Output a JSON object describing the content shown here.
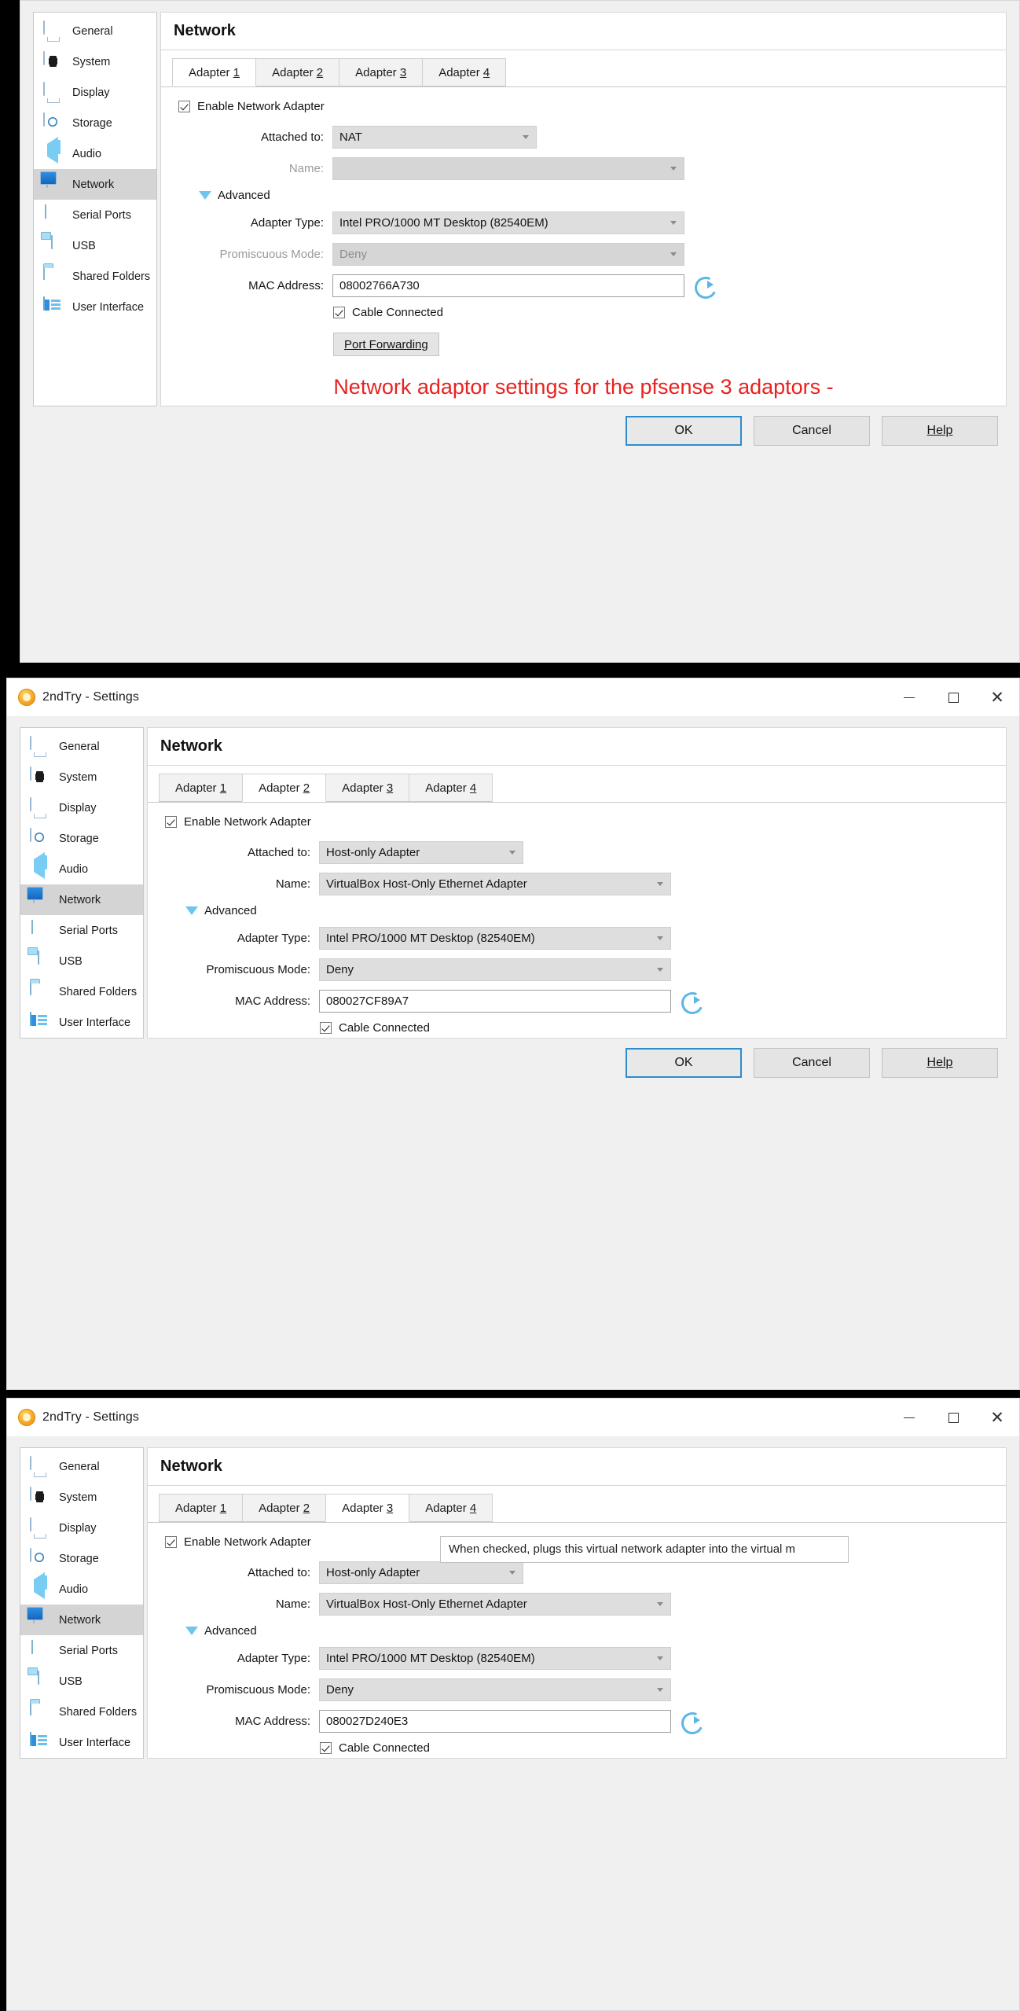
{
  "app": {
    "window_title": "2ndTry - Settings",
    "logo_icon": "virtualbox-logo-icon",
    "window_controls": {
      "minimize": "minimize-icon",
      "maximize": "maximize-icon",
      "close": "close-icon"
    }
  },
  "sidebar": {
    "items": [
      {
        "label": "General",
        "icon": "monitor-icon"
      },
      {
        "label": "System",
        "icon": "chip-icon"
      },
      {
        "label": "Display",
        "icon": "display-icon"
      },
      {
        "label": "Storage",
        "icon": "harddisk-icon"
      },
      {
        "label": "Audio",
        "icon": "speaker-icon"
      },
      {
        "label": "Network",
        "icon": "network-cards-icon"
      },
      {
        "label": "Serial Ports",
        "icon": "serial-port-icon"
      },
      {
        "label": "USB",
        "icon": "usb-plug-icon"
      },
      {
        "label": "Shared Folders",
        "icon": "folder-icon"
      },
      {
        "label": "User Interface",
        "icon": "layout-icon"
      }
    ],
    "selected": "Network"
  },
  "page": {
    "title": "Network"
  },
  "tabs": [
    {
      "label": "Adapter",
      "number": "1"
    },
    {
      "label": "Adapter",
      "number": "2"
    },
    {
      "label": "Adapter",
      "number": "3"
    },
    {
      "label": "Adapter",
      "number": "4"
    }
  ],
  "labels": {
    "enable_adapter": "Enable Network Adapter",
    "attached_to": "Attached to:",
    "name": "Name:",
    "advanced": "Advanced",
    "adapter_type": "Adapter Type:",
    "promiscuous_mode": "Promiscuous Mode:",
    "mac_address": "MAC Address:",
    "cable_connected": "Cable Connected",
    "port_forwarding": "Port Forwarding",
    "refresh_mac_icon": "refresh-icon",
    "advanced_toggle_icon": "triangle-down-icon"
  },
  "footer": {
    "ok": "OK",
    "cancel": "Cancel",
    "help": "Help"
  },
  "windows": [
    {
      "id": "window-adapter-1",
      "active_tab_index": 0,
      "enable_checked": true,
      "attached_to": "NAT",
      "name_value": "",
      "name_disabled": true,
      "adapter_type": "Intel PRO/1000 MT Desktop (82540EM)",
      "promiscuous_mode": "Deny",
      "promiscuous_disabled": true,
      "mac_address": "08002766A730",
      "cable_connected": true,
      "show_port_forwarding": true,
      "show_titlebar": false,
      "annotation": "Network adaptor settings for the pfsense 3 adaptors -",
      "annotation_color": "#e8221f",
      "tooltip": ""
    },
    {
      "id": "window-adapter-2",
      "active_tab_index": 1,
      "enable_checked": true,
      "attached_to": "Host-only Adapter",
      "name_value": "VirtualBox Host-Only Ethernet Adapter",
      "name_disabled": false,
      "adapter_type": "Intel PRO/1000 MT Desktop (82540EM)",
      "promiscuous_mode": "Deny",
      "promiscuous_disabled": false,
      "mac_address": "080027CF89A7",
      "cable_connected": true,
      "show_port_forwarding": false,
      "show_titlebar": true,
      "annotation": "",
      "tooltip": ""
    },
    {
      "id": "window-adapter-3",
      "active_tab_index": 2,
      "enable_checked": true,
      "attached_to": "Host-only Adapter",
      "name_value": "VirtualBox Host-Only Ethernet Adapter",
      "name_disabled": false,
      "adapter_type": "Intel PRO/1000 MT Desktop (82540EM)",
      "promiscuous_mode": "Deny",
      "promiscuous_disabled": false,
      "mac_address": "080027D240E3",
      "cable_connected": true,
      "show_port_forwarding": false,
      "show_titlebar": true,
      "annotation": "",
      "tooltip": "When checked, plugs this virtual network adapter into the virtual m"
    }
  ]
}
